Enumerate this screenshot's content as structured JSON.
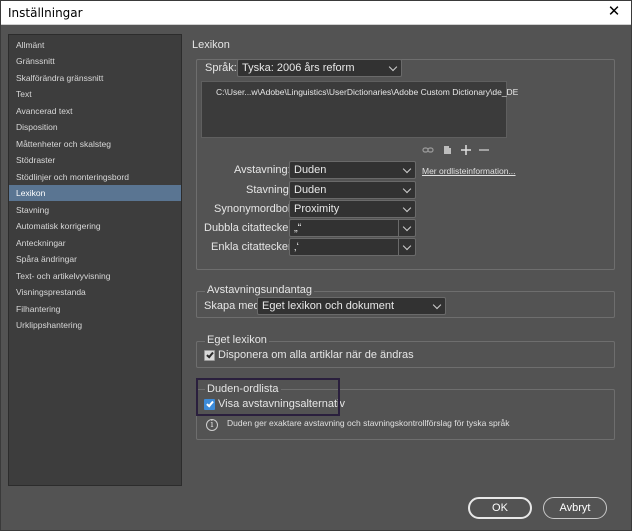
{
  "window": {
    "title": "Inställningar",
    "close_glyph": "✕"
  },
  "sidebar": {
    "items": [
      "Allmänt",
      "Gränssnitt",
      "Skalförändra gränssnitt",
      "Text",
      "Avancerad text",
      "Disposition",
      "Måttenheter och skalsteg",
      "Stödraster",
      "Stödlinjer och monteringsbord",
      "Lexikon",
      "Stavning",
      "Automatisk korrigering",
      "Anteckningar",
      "Spåra ändringar",
      "Text- och artikelvyvisning",
      "Visningsprestanda",
      "Filhantering",
      "Urklippshantering"
    ],
    "selected_index": 9
  },
  "lexicon": {
    "section_title": "Lexikon",
    "language_label": "Språk:",
    "language_value": "Tyska: 2006 års reform",
    "dictionary_path": "C:\\User...w\\Adobe\\Linguistics\\UserDictionaries\\Adobe Custom Dictionary\\de_DE",
    "icons": [
      "link-icon",
      "new-dictionary-icon",
      "add-icon",
      "remove-icon"
    ],
    "hyphenation_label": "Avstavning:",
    "hyphenation_value": "Duden",
    "more_info_link": "Mer ordlisteinformation...",
    "spelling_label": "Stavning:",
    "spelling_value": "Duden",
    "thesaurus_label": "Synonymordbok:",
    "thesaurus_value": "Proximity",
    "double_quotes_label": "Dubbla citattecken:",
    "double_quotes_value": "„“",
    "single_quotes_label": "Enkla citattecken:",
    "single_quotes_value": "‚‘"
  },
  "hyphenation_exceptions": {
    "title": "Avstavningsundantag",
    "create_with_label": "Skapa med:",
    "create_with_value": "Eget lexikon och dokument"
  },
  "own_lexicon": {
    "title": "Eget lexikon",
    "checkbox_label": "Disponera om alla artiklar när de ändras",
    "checked": true
  },
  "duden": {
    "title": "Duden-ordlista",
    "checkbox_label": "Visa avstavningsalternativ",
    "checked": true,
    "info_text": "Duden ger exaktare avstavning och stavningskontrollförslag för tyska språk"
  },
  "footer": {
    "ok_label": "OK",
    "cancel_label": "Avbryt"
  },
  "colors": {
    "accent": "#3c8bd9",
    "selection": "#5a7592",
    "background": "#535353"
  }
}
